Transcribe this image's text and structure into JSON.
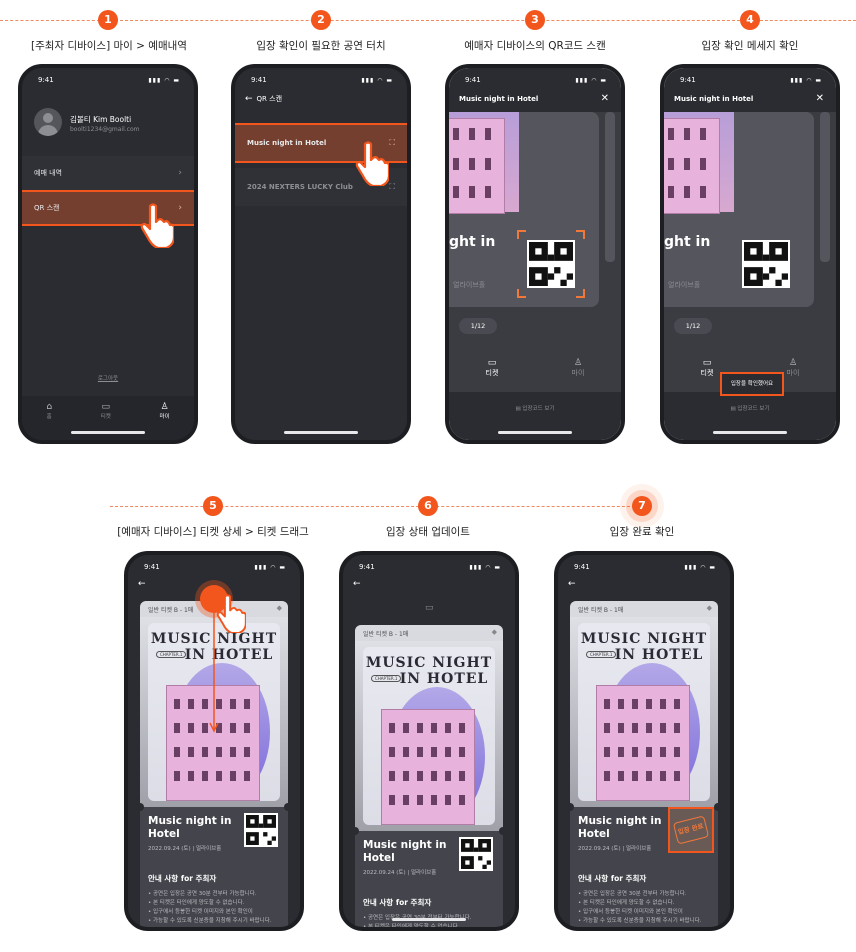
{
  "colors": {
    "accent": "#f2561d",
    "phone_bg": "#2b2c31",
    "highlight": "#b2502d"
  },
  "steps": [
    {
      "num": "1",
      "caption": "[주최자 디바이스] 마이 > 예매내역"
    },
    {
      "num": "2",
      "caption": "입장 확인이 필요한 공연 터치"
    },
    {
      "num": "3",
      "caption": "예매자 디바이스의 QR코드 스캔"
    },
    {
      "num": "4",
      "caption": "입장 확인 메세지 확인"
    },
    {
      "num": "5",
      "caption": "[예매자 디바이스] 티켓 상세 > 티켓 드래그"
    },
    {
      "num": "6",
      "caption": "입장 상태 업데이트"
    },
    {
      "num": "7",
      "caption": "입장 완료 확인"
    }
  ],
  "status_time": "9:41",
  "screen1": {
    "profile_name": "김볼티 Kim Boolti",
    "profile_email": "boolti1234@gmail.com",
    "menu_reservations": "예매 내역",
    "menu_qr": "QR 스캔",
    "logout": "로그아웃",
    "tabs": [
      "홈",
      "티켓",
      "마이"
    ]
  },
  "screen2": {
    "header": "QR 스캔",
    "shows": [
      "Music night in Hotel",
      "2024 NEXTERS LUCKY Club"
    ]
  },
  "screen3": {
    "header": "Music night in Hotel",
    "title_partial": "ght in",
    "venue_partial": "얼라이브홀",
    "page": "1/12",
    "tab_ticket": "티켓",
    "tab_my": "마이",
    "entry_code": "입장코드 보기",
    "toast": "입장을 확인했어요"
  },
  "ticket": {
    "type": "일반 티켓 B - 1매",
    "poster_line1": "MUSIC NIGHT",
    "poster_line2": "IN HOTEL",
    "poster_tag": "CHAPTER.1",
    "show_title_1": "Music night in",
    "show_title_2": "Hotel",
    "date": "2022.09.24 (토)",
    "venue": "얼라이브홀",
    "notice_title": "안내 사항 for 주최자",
    "notices": [
      "공연은 입장은 공연 30분 전부터 가능합니다.",
      "본 티켓은 타인에게 양도할 수 없습니다.",
      "입구에서 등봉한 티켓 이미지와 본인 확인이",
      "가능할 수 있도록 신분증을 지참해 주시기 바랍니다."
    ],
    "stamp": "입장 완료"
  }
}
